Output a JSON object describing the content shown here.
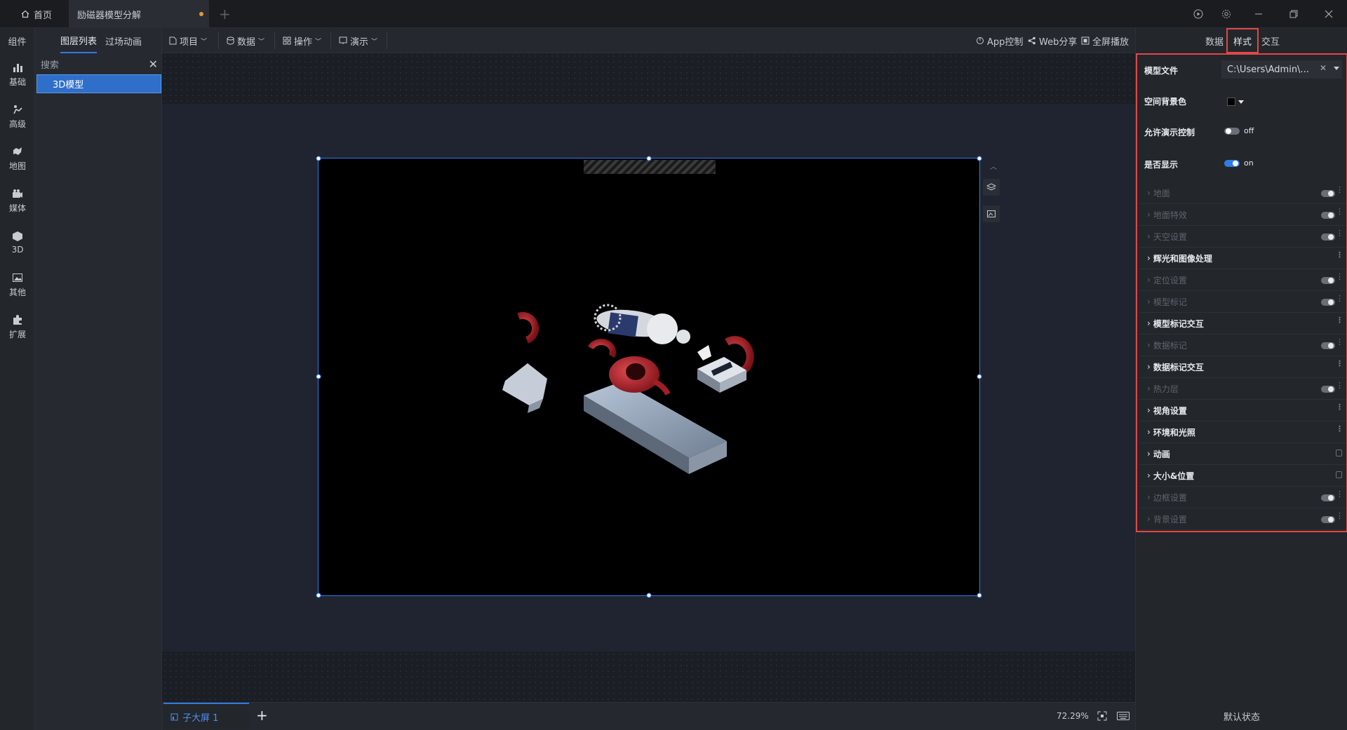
{
  "titlebar": {
    "home_tab": "首页",
    "doc_tab": "励磁器模型分解",
    "add_tab": "+"
  },
  "left_nav": {
    "header": "组件",
    "categories": [
      {
        "label": "基础",
        "icon": "bar-chart-icon"
      },
      {
        "label": "高级",
        "icon": "advanced-icon"
      },
      {
        "label": "地图",
        "icon": "map-icon"
      },
      {
        "label": "媒体",
        "icon": "camera-icon"
      },
      {
        "label": "3D",
        "icon": "cube-icon"
      },
      {
        "label": "其他",
        "icon": "image-icon"
      },
      {
        "label": "扩展",
        "icon": "puzzle-icon"
      }
    ]
  },
  "layer_panel": {
    "tab_layers": "图层列表",
    "tab_transition": "过场动画",
    "search_placeholder": "搜索",
    "items": [
      "3D模型"
    ]
  },
  "toolbar": {
    "project": "项目",
    "data": "数据",
    "operation": "操作",
    "demo": "演示",
    "app_control": "App控制",
    "web_share": "Web分享",
    "fullscreen": "全屏播放"
  },
  "bottom": {
    "screen_tab": "子大屏 1",
    "add": "+",
    "zoom": "72.29%"
  },
  "right_panel": {
    "tabs": [
      "数据",
      "样式",
      "交互"
    ],
    "active_tab": "样式",
    "model_file_label": "模型文件",
    "model_file_value": "C:\\Users\\Admin\\...",
    "bg_color_label": "空间背景色",
    "bg_color": "#000000",
    "demo_control_label": "允许演示控制",
    "demo_control_value": "off",
    "visible_label": "是否显示",
    "visible_value": "on",
    "sections": [
      {
        "label": "地面",
        "enabled": false,
        "control": "toggle"
      },
      {
        "label": "地面特效",
        "enabled": false,
        "control": "toggle"
      },
      {
        "label": "天空设置",
        "enabled": false,
        "control": "toggle"
      },
      {
        "label": "辉光和图像处理",
        "enabled": true,
        "control": "none"
      },
      {
        "label": "定位设置",
        "enabled": false,
        "control": "toggle"
      },
      {
        "label": "模型标记",
        "enabled": false,
        "control": "toggle"
      },
      {
        "label": "模型标记交互",
        "enabled": true,
        "control": "none"
      },
      {
        "label": "数据标记",
        "enabled": false,
        "control": "toggle"
      },
      {
        "label": "数据标记交互",
        "enabled": true,
        "control": "none"
      },
      {
        "label": "热力层",
        "enabled": false,
        "control": "toggle"
      },
      {
        "label": "视角设置",
        "enabled": true,
        "control": "none"
      },
      {
        "label": "环境和光照",
        "enabled": true,
        "control": "none"
      },
      {
        "label": "动画",
        "enabled": true,
        "control": "lock"
      },
      {
        "label": "大小&位置",
        "enabled": true,
        "control": "lock"
      },
      {
        "label": "边框设置",
        "enabled": false,
        "control": "toggle"
      },
      {
        "label": "背景设置",
        "enabled": false,
        "control": "toggle"
      }
    ],
    "default_state": "默认状态"
  },
  "colors": {
    "accent": "#2f7be8",
    "highlight_border": "#e04848",
    "unsaved_dot": "#e09a3c"
  }
}
